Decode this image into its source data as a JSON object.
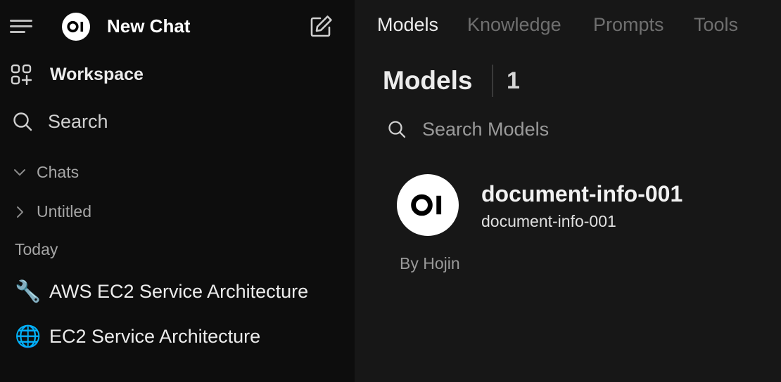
{
  "sidebar": {
    "new_chat_label": "New Chat",
    "workspace_label": "Workspace",
    "search_label": "Search",
    "chats_label": "Chats",
    "untitled_label": "Untitled",
    "today_label": "Today",
    "chats": [
      {
        "emoji": "🔧",
        "title": "AWS EC2 Service Architecture"
      },
      {
        "emoji": "🌐",
        "title": "EC2 Service Architecture"
      }
    ]
  },
  "tabs": [
    {
      "label": "Models",
      "active": true
    },
    {
      "label": "Knowledge",
      "active": false
    },
    {
      "label": "Prompts",
      "active": false
    },
    {
      "label": "Tools",
      "active": false
    }
  ],
  "main": {
    "title": "Models",
    "count": "1",
    "search_placeholder": "Search Models",
    "model": {
      "name": "document-info-001",
      "id": "document-info-001",
      "by": "By Hojin"
    }
  },
  "colors": {
    "sidebar_bg": "#0d0d0d",
    "main_bg": "#171717",
    "text_primary": "#ececec",
    "text_muted": "#6f6f6f",
    "logo_bg": "#ffffff"
  },
  "icons": [
    "menu-icon",
    "open-webui-logo-icon",
    "edit-icon",
    "workspace-icon",
    "search-icon",
    "chevron-down-icon",
    "chevron-right-icon",
    "wrench-emoji",
    "globe-emoji"
  ]
}
